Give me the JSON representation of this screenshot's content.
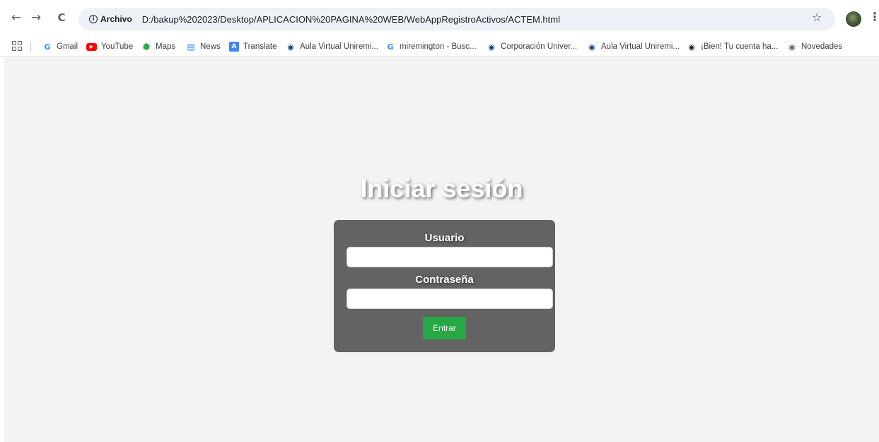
{
  "browser": {
    "back_icon": "←",
    "forward_icon": "→",
    "reload_icon": "C",
    "site_info_label": "Archivo",
    "url": "D:/bakup%202023/Desktop/APLICACION%20PAGINA%20WEB/WebAppRegistroActivos/ACTEM.html",
    "star_icon": "☆",
    "menu_icon": "⋮"
  },
  "bookmarks": [
    {
      "label": "Gmail",
      "icon": "G",
      "color": "#4285f4"
    },
    {
      "label": "YouTube",
      "icon": "▶",
      "color": "#ff0000"
    },
    {
      "label": "Maps",
      "icon": "⬢",
      "color": "#34a853"
    },
    {
      "label": "News",
      "icon": "▤",
      "color": "#4285f4"
    },
    {
      "label": "Translate",
      "icon": "A",
      "color": "#4285f4"
    },
    {
      "label": "Aula Virtual Uniremi...",
      "icon": "◉",
      "color": "#1a3c6e"
    },
    {
      "label": "miremington - Busc...",
      "icon": "G",
      "color": "#4285f4"
    },
    {
      "label": "Corporación Univer...",
      "icon": "◉",
      "color": "#1a3c6e"
    },
    {
      "label": "Aula Virtual Uniremi...",
      "icon": "◉",
      "color": "#1a3c6e"
    },
    {
      "label": "¡Bien! Tu cuenta ha...",
      "icon": "◉",
      "color": "#202124"
    },
    {
      "label": "Novedades",
      "icon": "◉",
      "color": "#5f6368"
    }
  ],
  "login": {
    "title": "Iniciar sesión",
    "user_label": "Usuario",
    "user_value": "",
    "password_label": "Contraseña",
    "password_value": "",
    "submit_label": "Entrar"
  },
  "colors": {
    "page_bg": "#f3f3f3",
    "card_bg": "#636363",
    "button_bg": "#28a745"
  }
}
